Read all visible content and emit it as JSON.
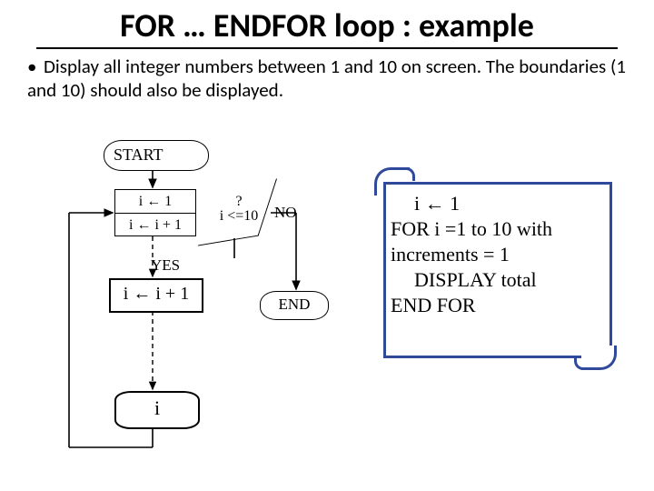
{
  "title": "FOR … ENDFOR loop : example",
  "bullet": "Display all integer numbers between 1 and 10 on screen. The boundaries (1 and 10) should also be displayed.",
  "flow": {
    "start": "START",
    "init": "i ← 1",
    "step": "i ← i + 1",
    "cond_q": "?",
    "cond": "i <=10",
    "yes": "YES",
    "no": "NO",
    "proc": "i ← i + 1",
    "display": "i",
    "end": "END"
  },
  "code": {
    "l1": "i ← 1",
    "l2": "FOR i =1 to 10 with",
    "l3": "increments = 1",
    "l4": "DISPLAY total",
    "l5": "END FOR"
  }
}
